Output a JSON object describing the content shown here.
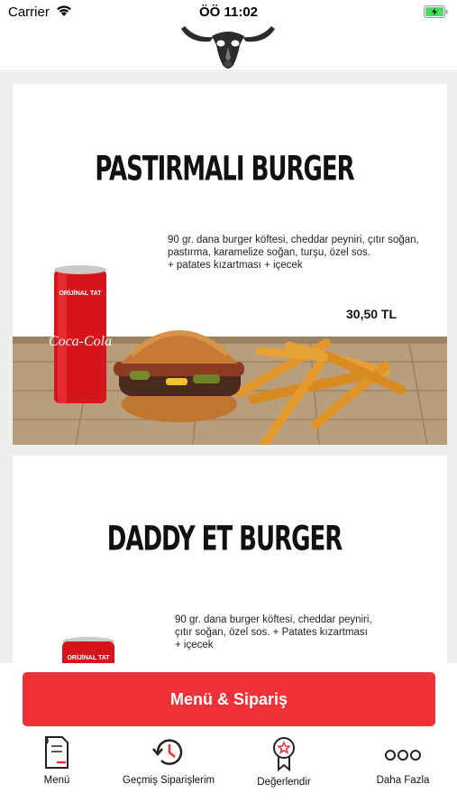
{
  "status_bar": {
    "carrier": "Carrier",
    "time": "ÖÖ 11:02"
  },
  "header": {
    "logo_icon": "bull-skull-logo"
  },
  "products": [
    {
      "title": "PASTIRMALI BURGER",
      "description": [
        "90 gr. dana burger köftesi, cheddar peyniri, çıtır soğan,",
        "pastırma, karamelize soğan, turşu, özel sos.",
        "+ patates kızartması + içecek"
      ],
      "price": "30,50 TL",
      "can_label": "ORİJİNAL TAT",
      "can_brand": "Coca-Cola"
    },
    {
      "title": "DADDY ET BURGER",
      "description": [
        "90 gr. dana burger köftesi, cheddar peyniri,",
        "çıtır soğan, özel sos. + Patates kızartması",
        "+ içecek"
      ],
      "can_label": "ORİJİNAL TAT"
    }
  ],
  "cta": {
    "label": "Menü & Sipariş"
  },
  "tabs": [
    {
      "label": "Menü",
      "icon": "menu-book-icon"
    },
    {
      "label": "Geçmiş Siparişlerim",
      "icon": "history-icon"
    },
    {
      "label": "Değerlendir",
      "icon": "award-badge-icon"
    },
    {
      "label": "Daha Fazla",
      "icon": "more-dots-icon"
    }
  ],
  "colors": {
    "accent": "#ee3136",
    "background": "#eeeeee",
    "battery": "#4cd964"
  }
}
